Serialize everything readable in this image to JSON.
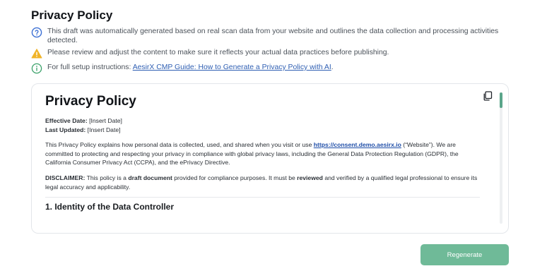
{
  "header": {
    "title": "Privacy Policy"
  },
  "notices": [
    {
      "icon": "question-circle-icon",
      "text": "This draft was automatically generated based on real scan data from your website and outlines the data collection and processing activities detected."
    },
    {
      "icon": "warning-triangle-icon",
      "text": "Please review and adjust the content to make sure it reflects your actual data practices before publishing."
    },
    {
      "icon": "info-circle-icon",
      "prefix": "For full setup instructions: ",
      "link": "AesirX CMP Guide: How to Generate a Privacy Policy with AI",
      "suffix": "."
    }
  ],
  "document": {
    "title": "Privacy Policy",
    "effective_label": "Effective Date:",
    "effective_value": " [Insert Date]",
    "updated_label": "Last Updated:",
    "updated_value": " [Insert Date]",
    "intro_before": "This Privacy Policy explains how personal data is collected, used, and shared when you visit or use ",
    "intro_link": "https://consent.demo.aesirx.io",
    "intro_after": " (“Website”). We are committed to protecting and respecting your privacy in compliance with global privacy laws, including the General Data Protection Regulation (GDPR), the California Consumer Privacy Act (CCPA), and the ePrivacy Directive.",
    "disclaimer_label": "DISCLAIMER:",
    "disclaimer_1": " This policy is a ",
    "disclaimer_bold1": "draft document",
    "disclaimer_2": " provided for compliance purposes. It must be ",
    "disclaimer_bold2": "reviewed",
    "disclaimer_3": " and verified by a qualified legal professional to ensure its legal accuracy and applicability.",
    "section_1_heading": "1. Identity of the Data Controller"
  },
  "actions": {
    "regenerate_label": "Regenerate"
  },
  "colors": {
    "accent": "#6fba98",
    "link": "#2f5fb3",
    "warning": "#f0b429",
    "info": "#3aa169",
    "question": "#3b6fd4"
  }
}
